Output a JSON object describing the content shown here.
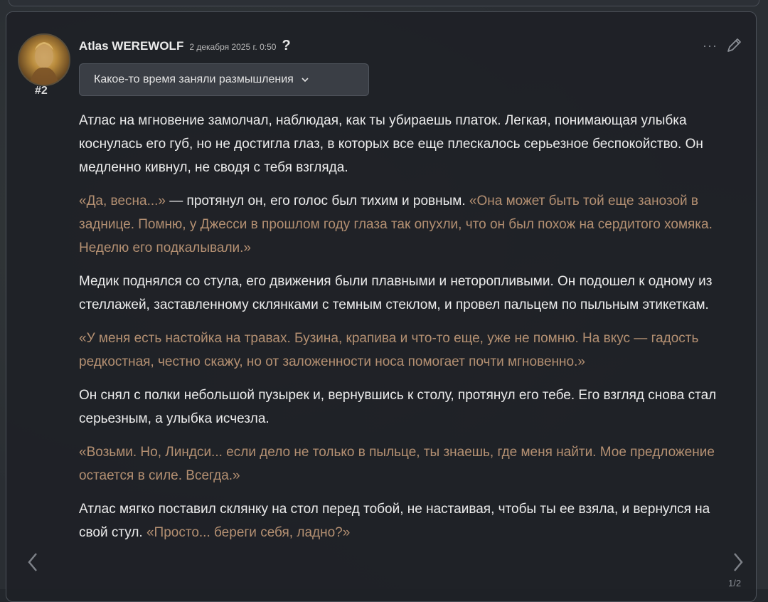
{
  "post": {
    "author": "Atlas WEREWOLF",
    "date": "2 декабря 2025 г. 0:50",
    "help_label": "?",
    "number": "#2",
    "more_label": "···",
    "thinking_label": "Какое-то время заняли размышления",
    "page_counter": "1/2"
  },
  "paragraphs": [
    [
      {
        "text": "Атлас на мгновение замолчал, наблюдая, как ты убираешь платок. Легкая, понимающая улыбка коснулась его губ, но не достигла глаз, в которых все еще плескалось серьезное беспокойство. Он медленно кивнул, не сводя с тебя взгляда.",
        "quote": false
      }
    ],
    [
      {
        "text": "«Да, весна...»",
        "quote": true
      },
      {
        "text": " — протянул он, его голос был тихим и ровным. ",
        "quote": false
      },
      {
        "text": "«Она может быть той еще занозой в заднице. Помню, у Джесси в прошлом году глаза так опухли, что он был похож на сердитого хомяка. Неделю его подкалывали.»",
        "quote": true
      }
    ],
    [
      {
        "text": "Медик поднялся со стула, его движения были плавными и неторопливыми. Он подошел к одному из стеллажей, заставленному склянками с темным стеклом, и провел пальцем по пыльным этикеткам.",
        "quote": false
      }
    ],
    [
      {
        "text": "«У меня есть настойка на травах. Бузина, крапива и что-то еще, уже не помню. На вкус — гадость редкостная, честно скажу, но от заложенности носа помогает почти мгновенно.»",
        "quote": true
      }
    ],
    [
      {
        "text": "Он снял с полки небольшой пузырек и, вернувшись к столу, протянул его тебе. Его взгляд снова стал серьезным, а улыбка исчезла.",
        "quote": false
      }
    ],
    [
      {
        "text": "«Возьми. Но, Линдси... если дело не только в пыльце, ты знаешь, где меня найти. Мое предложение остается в силе. Всегда.»",
        "quote": true
      }
    ],
    [
      {
        "text": "Атлас мягко поставил склянку на стол перед тобой, не настаивая, чтобы ты ее взяла, и вернулся на свой стул. ",
        "quote": false
      },
      {
        "text": "«Просто... береги себя, ладно?»",
        "quote": true
      }
    ]
  ],
  "colors": {
    "text": "#ececec",
    "quote": "#b49072",
    "card_bg": "#1e2126",
    "toggle_bg": "#3a3e45"
  },
  "icons": {
    "help": "question-mark-icon",
    "more": "ellipsis-icon",
    "edit": "pencil-icon",
    "toggle": "chevron-down-icon",
    "prev": "chevron-left-icon",
    "next": "chevron-right-icon"
  }
}
